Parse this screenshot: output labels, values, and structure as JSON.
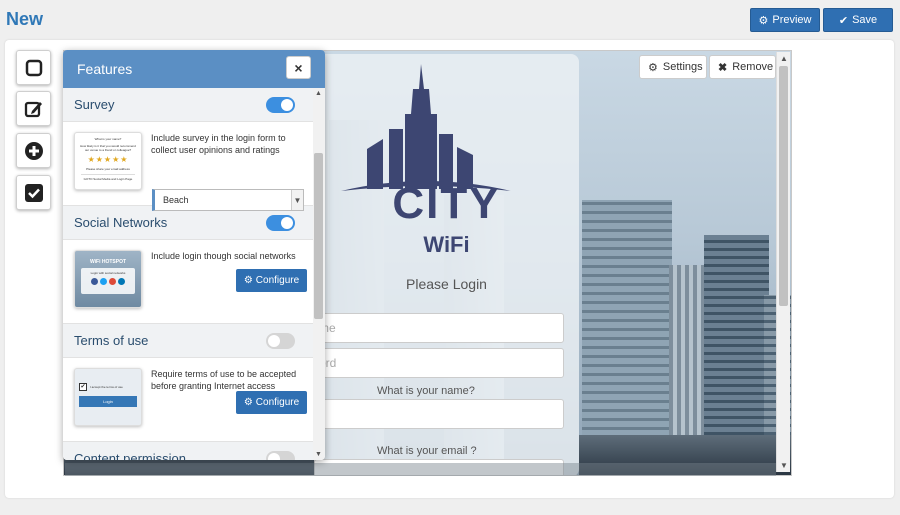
{
  "page": {
    "title": "New"
  },
  "toolbar": {
    "preview_label": "Preview",
    "save_label": "Save"
  },
  "canvas_controls": {
    "settings_label": "Settings",
    "remove_label": "Remove"
  },
  "login": {
    "brand_line1": "CITY",
    "brand_line2": "WiFi",
    "heading": "Please Login",
    "name_placeholder": "me",
    "password_placeholder": "ord",
    "q_name": "What is your name?",
    "q_email": "What is your email ?"
  },
  "features": {
    "title": "Features",
    "close_label": "×",
    "sections": [
      {
        "name": "Survey",
        "enabled": true,
        "description": "Include survey in the login form to collect user opinions and ratings",
        "select_value": "Beach"
      },
      {
        "name": "Social Networks",
        "enabled": true,
        "description": "Include login though social networks",
        "action": "Configure"
      },
      {
        "name": "Terms of use",
        "enabled": false,
        "description": "Require terms of use to be accepted before granting Internet access",
        "action": "Configure"
      },
      {
        "name": "Content permission",
        "enabled": false
      }
    ]
  },
  "thumbs": {
    "survey_title": "What is your name?",
    "survey_q": "How likely is it that you would recommend our venue to a friend or colleague?",
    "survey_foot": "Please share your email address",
    "survey_btn": "GOTO Social Media and Login Page",
    "social_brand": "WiFi HOTSPOT",
    "social_text": "Login with social networks",
    "terms_text": "I accept the terms of use",
    "terms_btn": "Login"
  },
  "colors": {
    "accent": "#2f6fb2",
    "panel_header": "#5b8fc4",
    "toggle_on": "#3c8fe0",
    "title": "#2f78b7"
  }
}
